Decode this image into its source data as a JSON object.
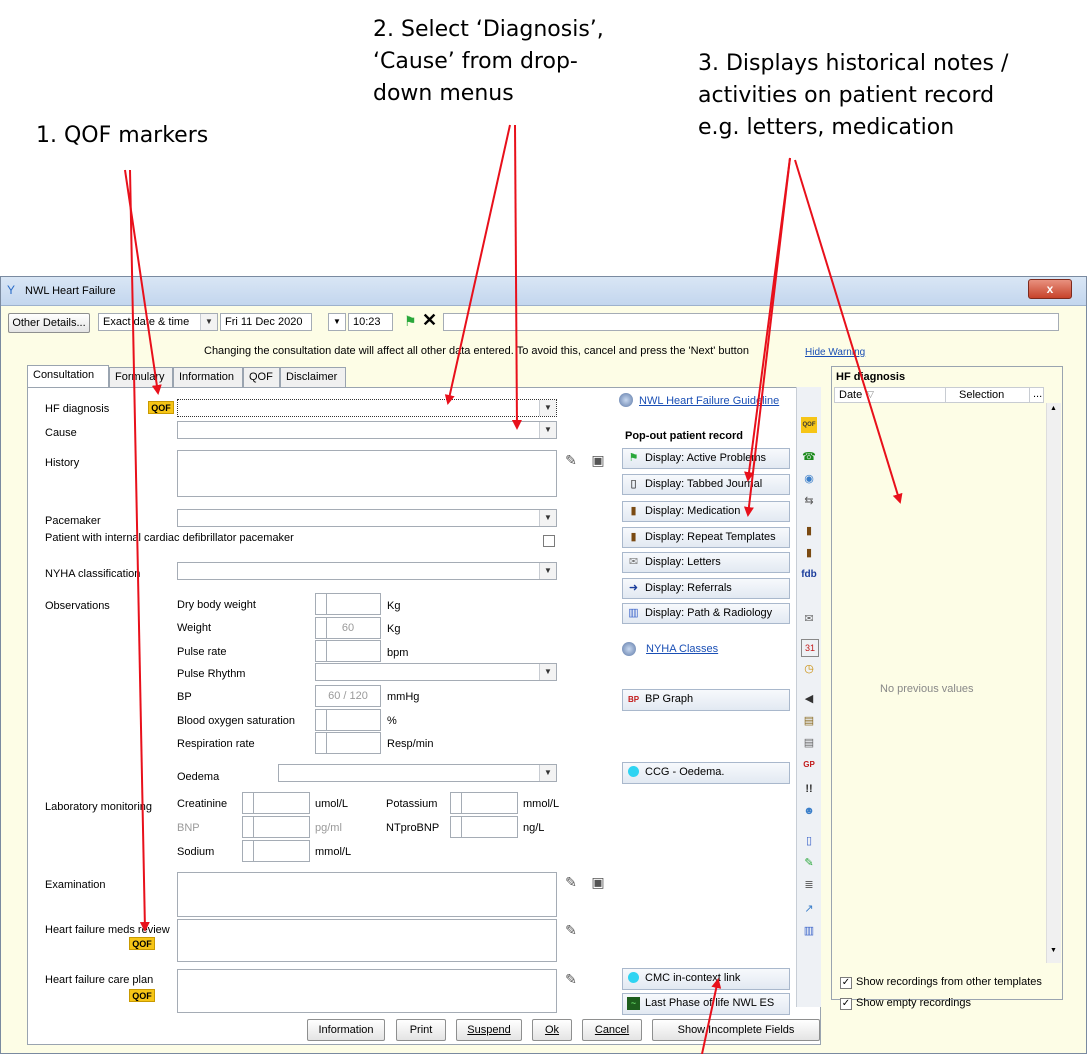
{
  "callouts": {
    "c1": "1. QOF markers",
    "c2": "2. Select ‘Diagnosis’,\n‘Cause’ from drop-\ndown menus",
    "c3": "3. Displays historical notes /\nactivities on patient record\ne.g. letters, medication"
  },
  "window": {
    "title": "NWL Heart Failure",
    "close_label": "x"
  },
  "top_bar": {
    "other_details": "Other Details...",
    "date_mode": "Exact date & time",
    "date_value": "Fri 11 Dec 2020",
    "time_value": "10:23"
  },
  "warning": {
    "text": "Changing the consultation date will affect all other data entered. To avoid this, cancel and press the 'Next' button",
    "hide_link": "Hide Warning"
  },
  "tabs": [
    "Consultation",
    "Formulary",
    "Information",
    "QOF",
    "Disclaimer"
  ],
  "form": {
    "hf_diagnosis": "HF diagnosis",
    "cause": "Cause",
    "history": "History",
    "pacemaker": "Pacemaker",
    "icd_pacemaker": "Patient with internal cardiac defibrillator pacemaker",
    "nyha": "NYHA classification",
    "observations": "Observations",
    "dry_weight": "Dry body weight",
    "weight": "Weight",
    "weight_value": "60",
    "pulse_rate": "Pulse rate",
    "pulse_rhythm": "Pulse Rhythm",
    "bp": "BP",
    "bp_value": "60 / 120",
    "oxygen": "Blood oxygen saturation",
    "respiration": "Respiration rate",
    "oedema": "Oedema",
    "lab": "Laboratory monitoring",
    "creatinine": "Creatinine",
    "bnp": "BNP",
    "sodium": "Sodium",
    "potassium": "Potassium",
    "ntprobnp": "NTproBNP",
    "examination": "Examination",
    "meds_review": "Heart failure meds review",
    "care_plan": "Heart failure care plan",
    "qof": "QOF",
    "units": {
      "kg": "Kg",
      "bpm": "bpm",
      "mmhg": "mmHg",
      "pct": "%",
      "resp": "Resp/min",
      "umol": "umol/L",
      "pgml": "pg/ml",
      "mmol": "mmol/L",
      "ngl": "ng/L"
    }
  },
  "side": {
    "guideline": "NWL Heart Failure Guideline",
    "popout_title": "Pop-out patient record",
    "buttons": [
      "Display: Active Problems",
      "Display: Tabbed Journal",
      "Display: Medication",
      "Display: Repeat Templates",
      "Display: Letters",
      "Display: Referrals",
      "Display: Path & Radiology"
    ],
    "nyha_classes": "NYHA Classes",
    "bp_graph": "BP Graph",
    "ccg_oedema": "CCG - Oedema.",
    "cmc_link": "CMC in-context link",
    "last_phase": "Last Phase of life NWL ES"
  },
  "toolbar_icons": [
    "QOF",
    "fdb",
    "!!"
  ],
  "history_panel": {
    "title": "HF diagnosis",
    "col_date": "Date",
    "col_selection": "Selection",
    "col_more": "...",
    "empty": "No previous values",
    "show_other": "Show recordings from other templates",
    "show_empty": "Show empty recordings"
  },
  "bottom_buttons": [
    "Information",
    "Print",
    "Suspend",
    "Ok",
    "Cancel",
    "Show Incomplete Fields"
  ]
}
